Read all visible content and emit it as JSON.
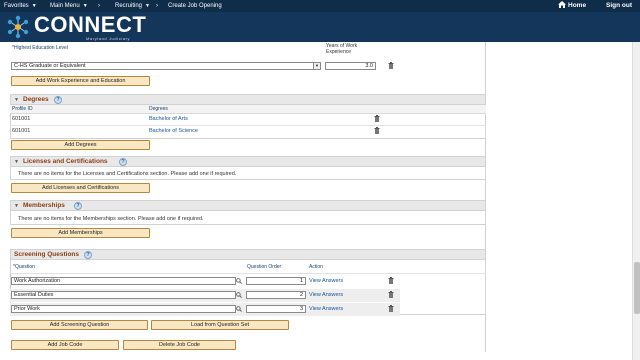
{
  "nav": {
    "favorites": "Favorites",
    "main_menu": "Main Menu",
    "sep1": "›",
    "recruiting": "Recruiting",
    "sep2": "›",
    "create_job_opening": "Create Job Opening",
    "home": "Home",
    "sign_out": "Sign out"
  },
  "brand": {
    "name": "CONNECT",
    "subtitle": "Maryland Judiciary"
  },
  "education": {
    "highest_level_label": "*Highest Education Level",
    "years_label": "Years of Work Experience",
    "level_value": "C-HS Graduate or Equivalent",
    "years_value": "3.0",
    "add_button": "Add Work Experience and Education"
  },
  "degrees": {
    "title": "Degrees",
    "col_profile_id": "Profile ID",
    "col_degrees": "Degrees",
    "rows": [
      {
        "profile_id": "601001",
        "degree": "Bachelor of Arts"
      },
      {
        "profile_id": "601001",
        "degree": "Bachelor of Science"
      }
    ],
    "add_button": "Add Degrees"
  },
  "licenses": {
    "title": "Licenses and Certifications",
    "empty_text": "There are no items for the Licenses and Certifications section.  Please add one if required.",
    "add_button": "Add Licenses and Certifications"
  },
  "memberships": {
    "title": "Memberships",
    "empty_text": "There are no items for the Memberships section.  Please add one if required.",
    "add_button": "Add Memberships"
  },
  "screening": {
    "title": "Screening Questions",
    "col_question": "*Question",
    "col_order": "Question Order",
    "col_action": "Action",
    "rows": [
      {
        "question": "Work Authorization",
        "order": "1",
        "action": "View Answers"
      },
      {
        "question": "Essential Duties",
        "order": "2",
        "action": "View Answers"
      },
      {
        "question": "Prior Work",
        "order": "3",
        "action": "View Answers"
      }
    ],
    "add_button": "Add Screening Question",
    "load_button": "Load from Question Set"
  },
  "footer": {
    "add_job_code": "Add Job Code",
    "delete_job_code": "Delete Job Code"
  },
  "icons": {
    "help": "?",
    "collapse": "▼",
    "caret": "▼"
  },
  "colors": {
    "nav_bg": "#0f2c49",
    "header_bg": "#13365a",
    "section_title": "#8a3e14",
    "button_bg": "#f9e6c2",
    "link": "#13519a"
  }
}
